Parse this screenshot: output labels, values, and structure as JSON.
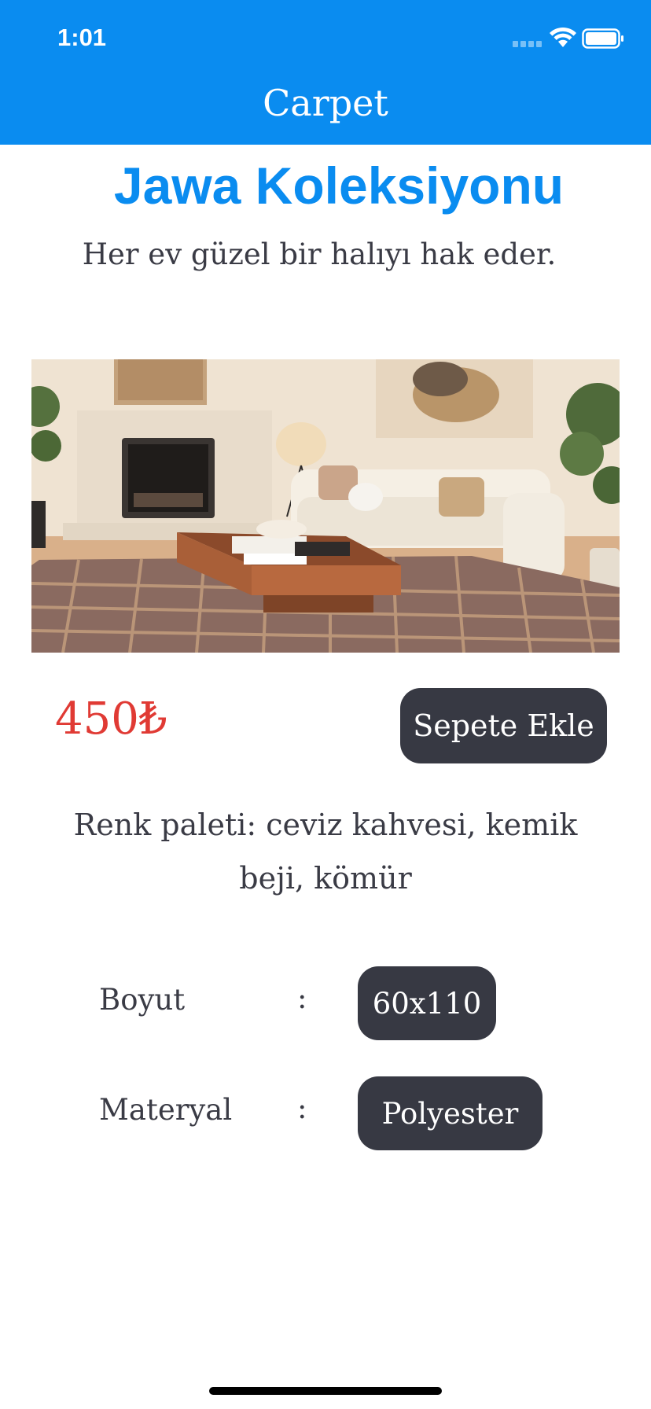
{
  "status_bar": {
    "time": "1:01"
  },
  "nav": {
    "title": "Carpet"
  },
  "product": {
    "collection_title": "Jawa Koleksiyonu",
    "tagline": "Her ev güzel bir halıyı hak eder.",
    "price": "450₺",
    "add_to_cart_label": "Sepete Ekle",
    "palette_text": "Renk paleti: ceviz kahvesi, kemik beji, kömür"
  },
  "specs": [
    {
      "label": "Boyut",
      "separator": ":",
      "value": "60x110"
    },
    {
      "label": "Materyal",
      "separator": ":",
      "value": "Polyester"
    }
  ],
  "colors": {
    "header_bg": "#0a8cf0",
    "title_blue": "#0a8cf0",
    "price_red": "#e03a34",
    "button_dark": "#373943",
    "text_dark": "#3a3b45"
  },
  "icons": {
    "signal": "cellular-signal-icon",
    "wifi": "wifi-icon",
    "battery": "battery-icon"
  }
}
